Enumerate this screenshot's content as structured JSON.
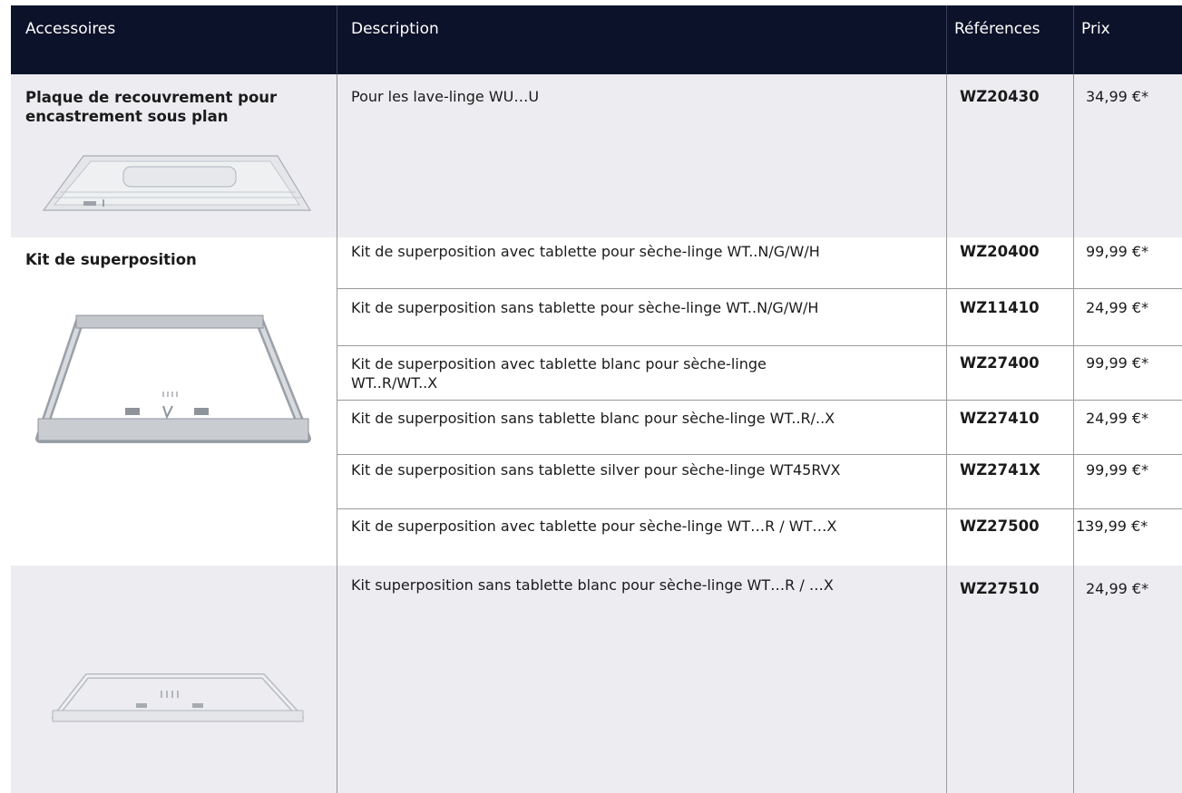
{
  "header": {
    "accessoires": "Accessoires",
    "description": "Description",
    "references": "Références",
    "prix": "Prix"
  },
  "colors": {
    "header_bg": "#0c1229",
    "row_alt_bg": "#ececf1",
    "row_bg": "#ffffff",
    "rule": "#9a9a9a"
  },
  "groups": [
    {
      "accessory": "Plaque de recouvrement pour encastrement sous plan",
      "image_icon": "cover-plate-image",
      "rows": [
        {
          "description": "Pour les lave-linge WU…U",
          "reference": "WZ20430",
          "price": "34,99 €*"
        }
      ]
    },
    {
      "accessory": "Kit de superposition",
      "image_icon": "stacking-kit-frame-image",
      "rows": [
        {
          "description": "Kit de superposition avec tablette pour sèche-linge WT..N/G/W/H",
          "reference": "WZ20400",
          "price": "99,99 €*"
        },
        {
          "description": "Kit de superposition sans tablette pour sèche-linge WT..N/G/W/H",
          "reference": "WZ11410",
          "price": "24,99 €*"
        },
        {
          "description": "Kit de superposition avec tablette blanc pour sèche-linge\nWT..R/WT..X",
          "reference": "WZ27400",
          "price": "99,99 €*"
        },
        {
          "description": "Kit de superposition sans tablette blanc pour sèche-linge WT..R/..X",
          "reference": "WZ27410",
          "price": "24,99 €*"
        },
        {
          "description": "Kit de superposition sans tablette silver pour sèche-linge WT45RVX",
          "reference": "WZ2741X",
          "price": "99,99 €*"
        },
        {
          "description": "Kit de superposition avec tablette pour sèche-linge WT…R / WT…X",
          "reference": "WZ27500",
          "price": "139,99 €*"
        }
      ]
    },
    {
      "accessory": "",
      "image_icon": "white-stacking-kit-image",
      "rows": [
        {
          "description": "Kit superposition sans tablette blanc pour sèche-linge WT…R / …X",
          "reference": "WZ27510",
          "price": "24,99 €*"
        }
      ]
    }
  ]
}
